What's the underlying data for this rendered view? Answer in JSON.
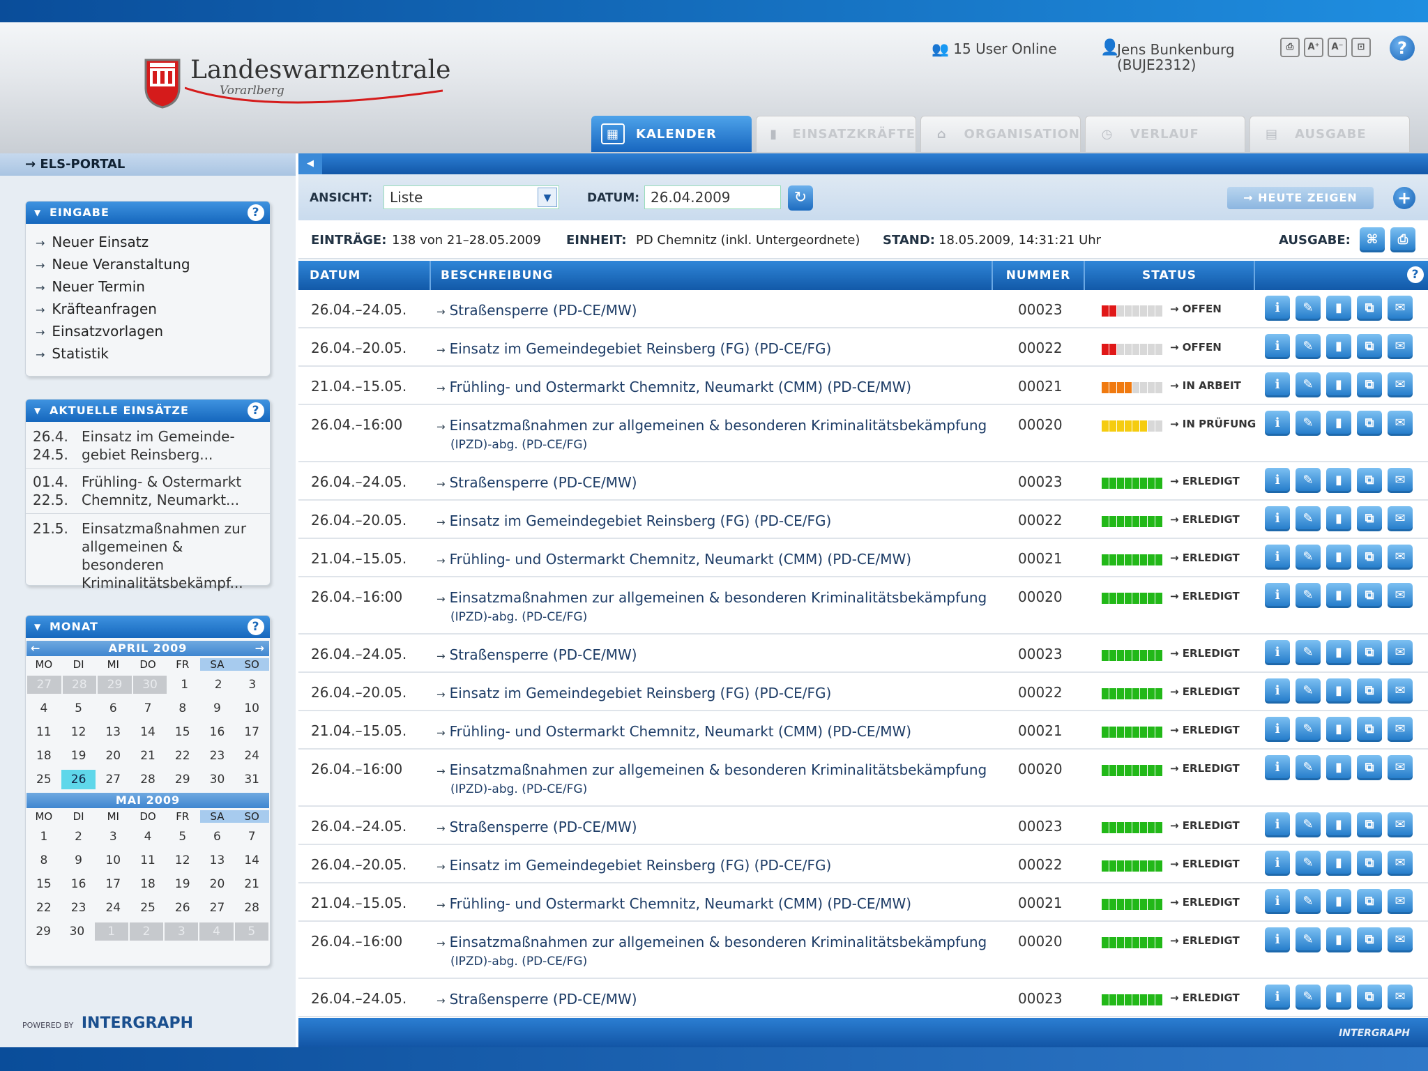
{
  "header": {
    "logo_title": "Landeswarnzentrale",
    "logo_subtitle": "Vorarlberg",
    "users_online": "15 User Online",
    "user_name": "Jens Bunkenburg",
    "user_id": "(BUJE2312)",
    "tool_buttons": [
      "print-icon",
      "font-larger-icon",
      "font-smaller-icon",
      "lock-icon"
    ],
    "help": "?"
  },
  "tabs": [
    {
      "label": "KALENDER",
      "icon": "calendar-icon",
      "active": true
    },
    {
      "label": "EINSATZKRÄFTE",
      "icon": "personnel-icon",
      "active": false
    },
    {
      "label": "ORGANISATION",
      "icon": "organisation-icon",
      "active": false
    },
    {
      "label": "VERLAUF",
      "icon": "clock-icon",
      "active": false
    },
    {
      "label": "AUSGABE",
      "icon": "document-icon",
      "active": false
    }
  ],
  "sidebar": {
    "portal_link": "ELS-PORTAL",
    "eingabe": {
      "title": "EINGABE",
      "items": [
        "Neuer Einsatz",
        "Neue Veranstaltung",
        "Neuer Termin",
        "Kräfteanfragen",
        "Einsatzvorlagen",
        "Statistik"
      ]
    },
    "aktuelle": {
      "title": "AKTUELLE EINSÄTZE",
      "items": [
        {
          "d1": "26.4.",
          "d2": "24.5.",
          "t1": "Einsatz im Gemeinde-",
          "t2": "gebiet Reinsberg...",
          "t3": ""
        },
        {
          "d1": "01.4.",
          "d2": "22.5.",
          "t1": "Frühling- & Ostermarkt",
          "t2": "Chemnitz, Neumarkt...",
          "t3": ""
        },
        {
          "d1": "21.5.",
          "d2": "",
          "t1": "Einsatzmaßnahmen zur",
          "t2": "allgemeinen & besonderen",
          "t3": "Kriminalitätsbekämpf..."
        }
      ]
    },
    "monat": {
      "title": "MONAT",
      "day_names": [
        "MO",
        "DI",
        "MI",
        "DO",
        "FR",
        "SA",
        "SO"
      ],
      "april": {
        "label": "APRIL 2009",
        "weeks": [
          [
            "27",
            "28",
            "29",
            "30",
            "1",
            "2",
            "3"
          ],
          [
            "4",
            "5",
            "6",
            "7",
            "8",
            "9",
            "10"
          ],
          [
            "11",
            "12",
            "13",
            "14",
            "15",
            "16",
            "17"
          ],
          [
            "18",
            "19",
            "20",
            "21",
            "22",
            "23",
            "24"
          ],
          [
            "25",
            "26",
            "27",
            "28",
            "29",
            "30",
            "31"
          ]
        ]
      },
      "mai": {
        "label": "MAI 2009",
        "weeks": [
          [
            "1",
            "2",
            "3",
            "4",
            "5",
            "6",
            "7"
          ],
          [
            "8",
            "9",
            "10",
            "11",
            "12",
            "13",
            "14"
          ],
          [
            "15",
            "16",
            "17",
            "18",
            "19",
            "20",
            "21"
          ],
          [
            "22",
            "23",
            "24",
            "25",
            "26",
            "27",
            "28"
          ],
          [
            "29",
            "30",
            "1",
            "2",
            "3",
            "4",
            "5"
          ]
        ]
      }
    },
    "powered_by": "POWERED BY",
    "powered_brand": "INTERGRAPH"
  },
  "toolbar": {
    "ansicht_label": "ANSICHT:",
    "ansicht_value": "Liste",
    "datum_label": "DATUM:",
    "datum_value": "26.04.2009",
    "today_button": "→ HEUTE ZEIGEN"
  },
  "infobar": {
    "eintraege_label": "EINTRÄGE:",
    "eintraege_value": "138 von 21–28.05.2009",
    "einheit_label": "EINHEIT:",
    "einheit_value": "PD Chemnitz (inkl. Untergeordnete)",
    "stand_label": "STAND:",
    "stand_value": "18.05.2009, 14:31:21 Uhr",
    "ausgabe_label": "AUSGABE:"
  },
  "table": {
    "headers": {
      "datum": "DATUM",
      "beschreibung": "BESCHREIBUNG",
      "nummer": "NUMMER",
      "status": "STATUS"
    },
    "status_colors": {
      "red": "#e01818",
      "orange": "#f07a10",
      "yellow": "#f5cc10",
      "green": "#22b818"
    },
    "action_icons": [
      "info-icon",
      "edit-icon",
      "personnel-icon",
      "copy-icon",
      "mail-icon"
    ],
    "rows": [
      {
        "date": "26.04.–24.05.",
        "desc1": "Straßensperre (PD-CE/MW)",
        "desc2": "",
        "num": "00023",
        "status": "→ OFFEN",
        "level": 0.2,
        "color": "red"
      },
      {
        "date": "26.04.–20.05.",
        "desc1": "Einsatz im Gemeindegebiet Reinsberg (FG) (PD-CE/FG)",
        "desc2": "",
        "num": "00022",
        "status": "→ OFFEN",
        "level": 0.2,
        "color": "red"
      },
      {
        "date": "21.04.–15.05.",
        "desc1": "Frühling- und Ostermarkt Chemnitz, Neumarkt (CMM) (PD-CE/MW)",
        "desc2": "",
        "num": "00021",
        "status": "→ IN ARBEIT",
        "level": 0.5,
        "color": "orange"
      },
      {
        "date": "26.04.–16:00",
        "desc1": "Einsatzmaßnahmen zur allgemeinen & besonderen Kriminalitätsbekämpfung",
        "desc2": "(IPZD)-abg. (PD-CE/FG)",
        "num": "00020",
        "status": "→ IN PRÜFUNG",
        "level": 0.7,
        "color": "yellow"
      },
      {
        "date": "26.04.–24.05.",
        "desc1": "Straßensperre (PD-CE/MW)",
        "desc2": "",
        "num": "00023",
        "status": "→ ERLEDIGT",
        "level": 1,
        "color": "green"
      },
      {
        "date": "26.04.–20.05.",
        "desc1": "Einsatz im Gemeindegebiet Reinsberg (FG) (PD-CE/FG)",
        "desc2": "",
        "num": "00022",
        "status": "→ ERLEDIGT",
        "level": 1,
        "color": "green"
      },
      {
        "date": "21.04.–15.05.",
        "desc1": "Frühling- und Ostermarkt Chemnitz, Neumarkt (CMM) (PD-CE/MW)",
        "desc2": "",
        "num": "00021",
        "status": "→ ERLEDIGT",
        "level": 1,
        "color": "green"
      },
      {
        "date": "26.04.–16:00",
        "desc1": "Einsatzmaßnahmen zur allgemeinen & besonderen Kriminalitätsbekämpfung",
        "desc2": "(IPZD)-abg. (PD-CE/FG)",
        "num": "00020",
        "status": "→ ERLEDIGT",
        "level": 1,
        "color": "green"
      },
      {
        "date": "26.04.–24.05.",
        "desc1": "Straßensperre (PD-CE/MW)",
        "desc2": "",
        "num": "00023",
        "status": "→ ERLEDIGT",
        "level": 1,
        "color": "green"
      },
      {
        "date": "26.04.–20.05.",
        "desc1": "Einsatz im Gemeindegebiet Reinsberg (FG) (PD-CE/FG)",
        "desc2": "",
        "num": "00022",
        "status": "→ ERLEDIGT",
        "level": 1,
        "color": "green"
      },
      {
        "date": "21.04.–15.05.",
        "desc1": "Frühling- und Ostermarkt Chemnitz, Neumarkt (CMM) (PD-CE/MW)",
        "desc2": "",
        "num": "00021",
        "status": "→ ERLEDIGT",
        "level": 1,
        "color": "green"
      },
      {
        "date": "26.04.–16:00",
        "desc1": "Einsatzmaßnahmen zur allgemeinen & besonderen Kriminalitätsbekämpfung",
        "desc2": "(IPZD)-abg. (PD-CE/FG)",
        "num": "00020",
        "status": "→ ERLEDIGT",
        "level": 1,
        "color": "green"
      },
      {
        "date": "26.04.–24.05.",
        "desc1": "Straßensperre (PD-CE/MW)",
        "desc2": "",
        "num": "00023",
        "status": "→ ERLEDIGT",
        "level": 1,
        "color": "green"
      },
      {
        "date": "26.04.–20.05.",
        "desc1": "Einsatz im Gemeindegebiet Reinsberg (FG) (PD-CE/FG)",
        "desc2": "",
        "num": "00022",
        "status": "→ ERLEDIGT",
        "level": 1,
        "color": "green"
      },
      {
        "date": "21.04.–15.05.",
        "desc1": "Frühling- und Ostermarkt Chemnitz, Neumarkt (CMM) (PD-CE/MW)",
        "desc2": "",
        "num": "00021",
        "status": "→ ERLEDIGT",
        "level": 1,
        "color": "green"
      },
      {
        "date": "26.04.–16:00",
        "desc1": "Einsatzmaßnahmen zur allgemeinen & besonderen Kriminalitätsbekämpfung",
        "desc2": "(IPZD)-abg. (PD-CE/FG)",
        "num": "00020",
        "status": "→ ERLEDIGT",
        "level": 1,
        "color": "green"
      },
      {
        "date": "26.04.–24.05.",
        "desc1": "Straßensperre (PD-CE/MW)",
        "desc2": "",
        "num": "00023",
        "status": "→ ERLEDIGT",
        "level": 1,
        "color": "green"
      }
    ]
  },
  "footer_brand": "INTERGRAPH"
}
